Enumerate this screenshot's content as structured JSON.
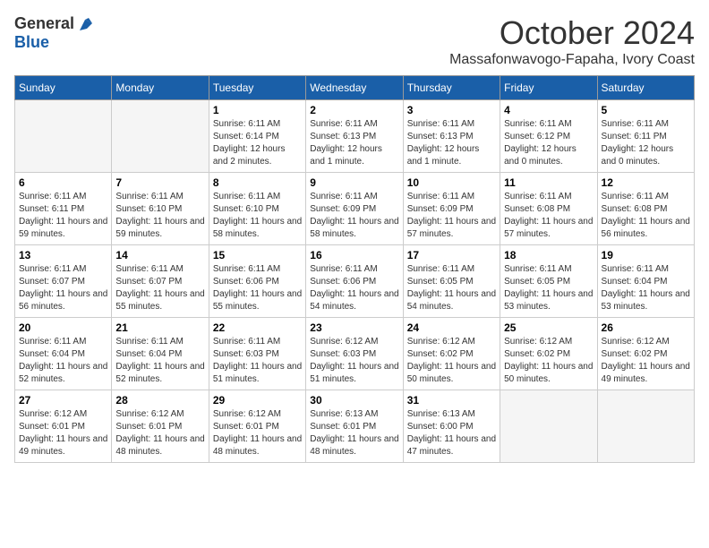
{
  "header": {
    "logo_general": "General",
    "logo_blue": "Blue",
    "title": "October 2024",
    "location": "Massafonwavogo-Fapaha, Ivory Coast"
  },
  "weekdays": [
    "Sunday",
    "Monday",
    "Tuesday",
    "Wednesday",
    "Thursday",
    "Friday",
    "Saturday"
  ],
  "weeks": [
    [
      {
        "day": "",
        "info": ""
      },
      {
        "day": "",
        "info": ""
      },
      {
        "day": "1",
        "info": "Sunrise: 6:11 AM\nSunset: 6:14 PM\nDaylight: 12 hours\nand 2 minutes."
      },
      {
        "day": "2",
        "info": "Sunrise: 6:11 AM\nSunset: 6:13 PM\nDaylight: 12 hours\nand 1 minute."
      },
      {
        "day": "3",
        "info": "Sunrise: 6:11 AM\nSunset: 6:13 PM\nDaylight: 12 hours\nand 1 minute."
      },
      {
        "day": "4",
        "info": "Sunrise: 6:11 AM\nSunset: 6:12 PM\nDaylight: 12 hours\nand 0 minutes."
      },
      {
        "day": "5",
        "info": "Sunrise: 6:11 AM\nSunset: 6:11 PM\nDaylight: 12 hours\nand 0 minutes."
      }
    ],
    [
      {
        "day": "6",
        "info": "Sunrise: 6:11 AM\nSunset: 6:11 PM\nDaylight: 11 hours\nand 59 minutes."
      },
      {
        "day": "7",
        "info": "Sunrise: 6:11 AM\nSunset: 6:10 PM\nDaylight: 11 hours\nand 59 minutes."
      },
      {
        "day": "8",
        "info": "Sunrise: 6:11 AM\nSunset: 6:10 PM\nDaylight: 11 hours\nand 58 minutes."
      },
      {
        "day": "9",
        "info": "Sunrise: 6:11 AM\nSunset: 6:09 PM\nDaylight: 11 hours\nand 58 minutes."
      },
      {
        "day": "10",
        "info": "Sunrise: 6:11 AM\nSunset: 6:09 PM\nDaylight: 11 hours\nand 57 minutes."
      },
      {
        "day": "11",
        "info": "Sunrise: 6:11 AM\nSunset: 6:08 PM\nDaylight: 11 hours\nand 57 minutes."
      },
      {
        "day": "12",
        "info": "Sunrise: 6:11 AM\nSunset: 6:08 PM\nDaylight: 11 hours\nand 56 minutes."
      }
    ],
    [
      {
        "day": "13",
        "info": "Sunrise: 6:11 AM\nSunset: 6:07 PM\nDaylight: 11 hours\nand 56 minutes."
      },
      {
        "day": "14",
        "info": "Sunrise: 6:11 AM\nSunset: 6:07 PM\nDaylight: 11 hours\nand 55 minutes."
      },
      {
        "day": "15",
        "info": "Sunrise: 6:11 AM\nSunset: 6:06 PM\nDaylight: 11 hours\nand 55 minutes."
      },
      {
        "day": "16",
        "info": "Sunrise: 6:11 AM\nSunset: 6:06 PM\nDaylight: 11 hours\nand 54 minutes."
      },
      {
        "day": "17",
        "info": "Sunrise: 6:11 AM\nSunset: 6:05 PM\nDaylight: 11 hours\nand 54 minutes."
      },
      {
        "day": "18",
        "info": "Sunrise: 6:11 AM\nSunset: 6:05 PM\nDaylight: 11 hours\nand 53 minutes."
      },
      {
        "day": "19",
        "info": "Sunrise: 6:11 AM\nSunset: 6:04 PM\nDaylight: 11 hours\nand 53 minutes."
      }
    ],
    [
      {
        "day": "20",
        "info": "Sunrise: 6:11 AM\nSunset: 6:04 PM\nDaylight: 11 hours\nand 52 minutes."
      },
      {
        "day": "21",
        "info": "Sunrise: 6:11 AM\nSunset: 6:04 PM\nDaylight: 11 hours\nand 52 minutes."
      },
      {
        "day": "22",
        "info": "Sunrise: 6:11 AM\nSunset: 6:03 PM\nDaylight: 11 hours\nand 51 minutes."
      },
      {
        "day": "23",
        "info": "Sunrise: 6:12 AM\nSunset: 6:03 PM\nDaylight: 11 hours\nand 51 minutes."
      },
      {
        "day": "24",
        "info": "Sunrise: 6:12 AM\nSunset: 6:02 PM\nDaylight: 11 hours\nand 50 minutes."
      },
      {
        "day": "25",
        "info": "Sunrise: 6:12 AM\nSunset: 6:02 PM\nDaylight: 11 hours\nand 50 minutes."
      },
      {
        "day": "26",
        "info": "Sunrise: 6:12 AM\nSunset: 6:02 PM\nDaylight: 11 hours\nand 49 minutes."
      }
    ],
    [
      {
        "day": "27",
        "info": "Sunrise: 6:12 AM\nSunset: 6:01 PM\nDaylight: 11 hours\nand 49 minutes."
      },
      {
        "day": "28",
        "info": "Sunrise: 6:12 AM\nSunset: 6:01 PM\nDaylight: 11 hours\nand 48 minutes."
      },
      {
        "day": "29",
        "info": "Sunrise: 6:12 AM\nSunset: 6:01 PM\nDaylight: 11 hours\nand 48 minutes."
      },
      {
        "day": "30",
        "info": "Sunrise: 6:13 AM\nSunset: 6:01 PM\nDaylight: 11 hours\nand 48 minutes."
      },
      {
        "day": "31",
        "info": "Sunrise: 6:13 AM\nSunset: 6:00 PM\nDaylight: 11 hours\nand 47 minutes."
      },
      {
        "day": "",
        "info": ""
      },
      {
        "day": "",
        "info": ""
      }
    ]
  ]
}
